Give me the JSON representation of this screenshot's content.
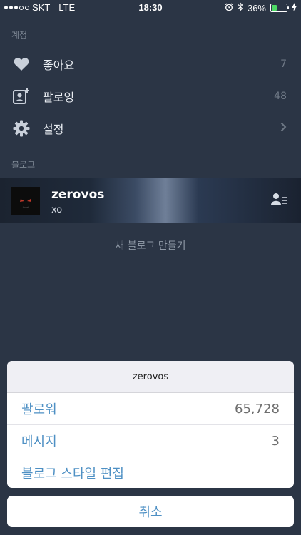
{
  "status_bar": {
    "carrier": "SKT",
    "network": "LTE",
    "time": "18:30",
    "battery_percent": "36%",
    "battery_level": 0.36,
    "icons": [
      "alarm-icon",
      "bluetooth-icon",
      "battery-icon",
      "charging-icon"
    ]
  },
  "account": {
    "header": "계정",
    "items": [
      {
        "icon": "heart-icon",
        "label": "좋아요",
        "value": "7"
      },
      {
        "icon": "following-icon",
        "label": "팔로잉",
        "value": "48"
      },
      {
        "icon": "gear-icon",
        "label": "설정",
        "value": ""
      }
    ]
  },
  "blogs": {
    "header": "블로그",
    "blog": {
      "name": "zerovos",
      "description": "xo"
    },
    "new_blog_label": "새 블로그 만들기"
  },
  "action_sheet": {
    "title": "zerovos",
    "items": [
      {
        "label": "팔로워",
        "value": "65,728"
      },
      {
        "label": "메시지",
        "value": "3"
      },
      {
        "label": "블로그 스타일 편집",
        "value": ""
      }
    ],
    "cancel_label": "취소"
  },
  "colors": {
    "background": "#2b3545",
    "accent": "#4e90c4",
    "battery": "#4cd964"
  }
}
